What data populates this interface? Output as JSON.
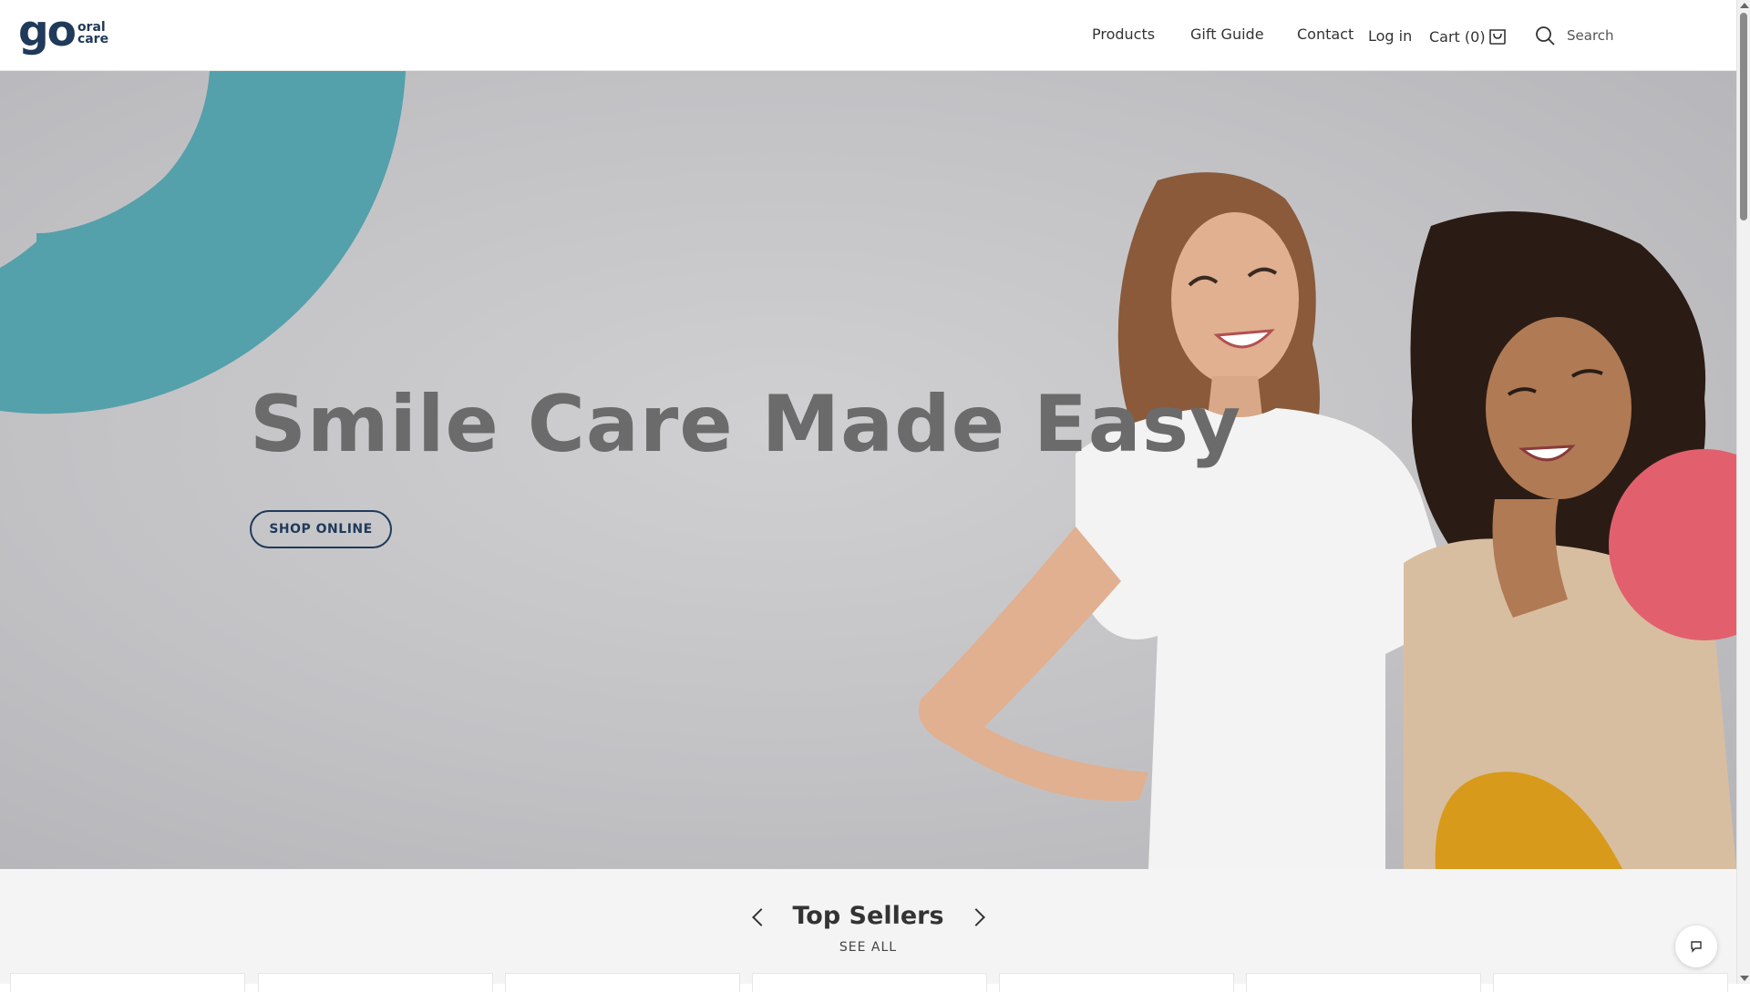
{
  "header": {
    "logo": {
      "main": "go",
      "line1": "oral",
      "line2": "care"
    },
    "nav": {
      "products": "Products",
      "gift_guide": "Gift Guide",
      "contact": "Contact",
      "login": "Log in",
      "cart": "Cart (0)",
      "search": "Search"
    }
  },
  "hero": {
    "title": "Smile Care Made Easy",
    "cta": "SHOP ONLINE"
  },
  "top_sellers": {
    "title": "Top Sellers",
    "see_all": "SEE ALL"
  },
  "colors": {
    "brand_navy": "#1f3a5a",
    "teal": "#54a0ab",
    "pink": "#e2606e",
    "mustard": "#d89a1a"
  },
  "icons": [
    "cart-icon",
    "search-icon",
    "chevron-left-icon",
    "chevron-right-icon",
    "chat-icon"
  ]
}
